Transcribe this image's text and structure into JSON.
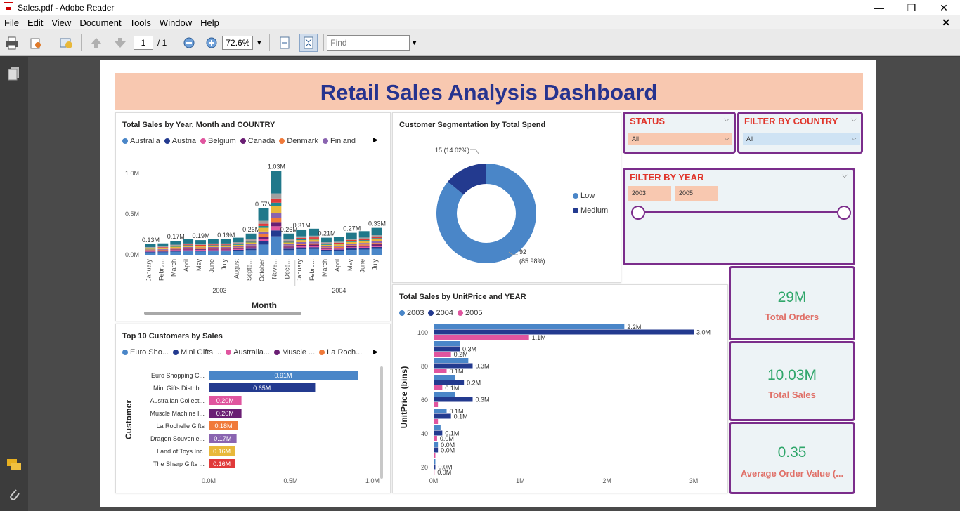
{
  "window": {
    "title": "Sales.pdf - Adobe Reader"
  },
  "menu": [
    "File",
    "Edit",
    "View",
    "Document",
    "Tools",
    "Window",
    "Help"
  ],
  "toolbar": {
    "page_current": "1",
    "page_total": "/ 1",
    "zoom": "72.6%",
    "find_placeholder": "Find"
  },
  "dashboard": {
    "title": "Retail Sales Analysis Dashboard",
    "status": {
      "title": "STATUS",
      "value": "All"
    },
    "country": {
      "title": "FILTER BY COUNTRY",
      "value": "All"
    },
    "year": {
      "title": "FILTER BY YEAR",
      "from": "2003",
      "to": "2005"
    },
    "kpis": [
      {
        "value": "29M",
        "label": "Total Orders"
      },
      {
        "value": "10.03M",
        "label": "Total Sales"
      },
      {
        "value": "0.35",
        "label": "Average Order Value (..."
      }
    ],
    "colors": {
      "title": "#26338f",
      "banner": "#f8c8b0",
      "border": "#7b2d8b",
      "kpi_value": "#2fa66a",
      "kpi_label": "#e07068"
    }
  },
  "chart_data": [
    {
      "type": "bar",
      "title": "Total Sales by Year, Month and COUNTRY",
      "xlabel": "Month",
      "legend": [
        {
          "name": "Australia",
          "color": "#4a86c8"
        },
        {
          "name": "Austria",
          "color": "#233a8f"
        },
        {
          "name": "Belgium",
          "color": "#e0559f"
        },
        {
          "name": "Canada",
          "color": "#6a1e74"
        },
        {
          "name": "Denmark",
          "color": "#f07a3a"
        },
        {
          "name": "Finland",
          "color": "#8a64b0"
        }
      ],
      "years": [
        "2003",
        "2004"
      ],
      "categories": [
        "January",
        "Febru...",
        "March",
        "April",
        "May",
        "June",
        "July",
        "August",
        "Septe...",
        "October",
        "Nove...",
        "Dece...",
        "January",
        "Febru...",
        "March",
        "April",
        "May",
        "June",
        "July"
      ],
      "values": [
        0.13,
        0.14,
        0.17,
        0.19,
        0.18,
        0.19,
        0.19,
        0.21,
        0.26,
        0.57,
        1.03,
        0.26,
        0.31,
        0.32,
        0.21,
        0.22,
        0.27,
        0.29,
        0.33
      ],
      "data_labels": [
        "0.13M",
        "",
        "0.17M",
        "",
        "0.19M",
        "",
        "0.19M",
        "",
        "0.26M",
        "0.57M",
        "1.03M",
        "0.26M",
        "0.31M",
        "",
        "0.21M",
        "",
        "0.27M",
        "",
        "0.33M"
      ],
      "yticks": [
        "0.0M",
        "0.5M",
        "1.0M"
      ],
      "ylim": [
        0,
        1.05
      ]
    },
    {
      "type": "pie",
      "title": "Customer Segmentation by Total Spend",
      "slices": [
        {
          "name": "Low",
          "value": 92,
          "label": "92",
          "pct_label": "(85.98%)",
          "color": "#4a86c8"
        },
        {
          "name": "Medium",
          "value": 15,
          "label": "15 (14.02%)",
          "color": "#233a8f"
        }
      ]
    },
    {
      "type": "bar",
      "title": "Top 10 Customers by Sales",
      "ylabel": "Customer",
      "legend": [
        {
          "name": "Euro Sho...",
          "color": "#4a86c8"
        },
        {
          "name": "Mini Gifts ...",
          "color": "#233a8f"
        },
        {
          "name": "Australia...",
          "color": "#e0559f"
        },
        {
          "name": "Muscle ...",
          "color": "#6a1e74"
        },
        {
          "name": "La Roch...",
          "color": "#f07a3a"
        }
      ],
      "categories": [
        "Euro Shopping C...",
        "Mini Gifts Distrib...",
        "Australian Collect...",
        "Muscle Machine I...",
        "La Rochelle Gifts",
        "Dragon Souvenie...",
        "Land of Toys Inc.",
        "The Sharp Gifts ..."
      ],
      "values": [
        0.91,
        0.65,
        0.2,
        0.2,
        0.18,
        0.17,
        0.16,
        0.16
      ],
      "data_labels": [
        "0.91M",
        "0.65M",
        "0.20M",
        "0.20M",
        "0.18M",
        "0.17M",
        "0.16M",
        "0.16M"
      ],
      "colors": [
        "#4a86c8",
        "#233a8f",
        "#e0559f",
        "#6a1e74",
        "#f07a3a",
        "#8a64b0",
        "#e8b83a",
        "#e03a3a"
      ],
      "xticks": [
        "0.0M",
        "0.5M",
        "1.0M"
      ],
      "xlim": [
        0,
        1.0
      ]
    },
    {
      "type": "bar",
      "title": "Total Sales by UnitPrice and YEAR",
      "ylabel": "UnitPrice (bins)",
      "legend": [
        {
          "name": "2003",
          "color": "#4a86c8"
        },
        {
          "name": "2004",
          "color": "#233a8f"
        },
        {
          "name": "2005",
          "color": "#e0559f"
        }
      ],
      "groups": [
        {
          "values": [
            2.2,
            3.0,
            1.1
          ],
          "labels": [
            "2.2M",
            "3.0M",
            "1.1M"
          ]
        },
        {
          "values": [
            0.3,
            0.3,
            0.2
          ],
          "labels": [
            "",
            "0.3M",
            "0.2M"
          ]
        },
        {
          "values": [
            0.4,
            0.45,
            0.15
          ],
          "labels": [
            "",
            "0.3M",
            "0.1M"
          ]
        },
        {
          "values": [
            0.25,
            0.35,
            0.1
          ],
          "labels": [
            "",
            "0.2M",
            "0.1M"
          ]
        },
        {
          "values": [
            0.25,
            0.45,
            0.05
          ],
          "labels": [
            "",
            "0.3M",
            ""
          ]
        },
        {
          "values": [
            0.15,
            0.2,
            0.05
          ],
          "labels": [
            "0.1M",
            "0.1M",
            ""
          ]
        },
        {
          "values": [
            0.08,
            0.1,
            0.04
          ],
          "labels": [
            "",
            "0.1M",
            "0.0M"
          ]
        },
        {
          "values": [
            0.05,
            0.05,
            0.02
          ],
          "labels": [
            "0.0M",
            "0.0M",
            ""
          ]
        },
        {
          "values": [
            0.02,
            0.02,
            0.01
          ],
          "labels": [
            "",
            "0.0M",
            "0.0M"
          ]
        }
      ],
      "yticks": [
        "100",
        "80",
        "60",
        "40",
        "20"
      ],
      "xticks": [
        "0M",
        "1M",
        "2M",
        "3M"
      ],
      "xlim": [
        0,
        3.0
      ]
    }
  ]
}
